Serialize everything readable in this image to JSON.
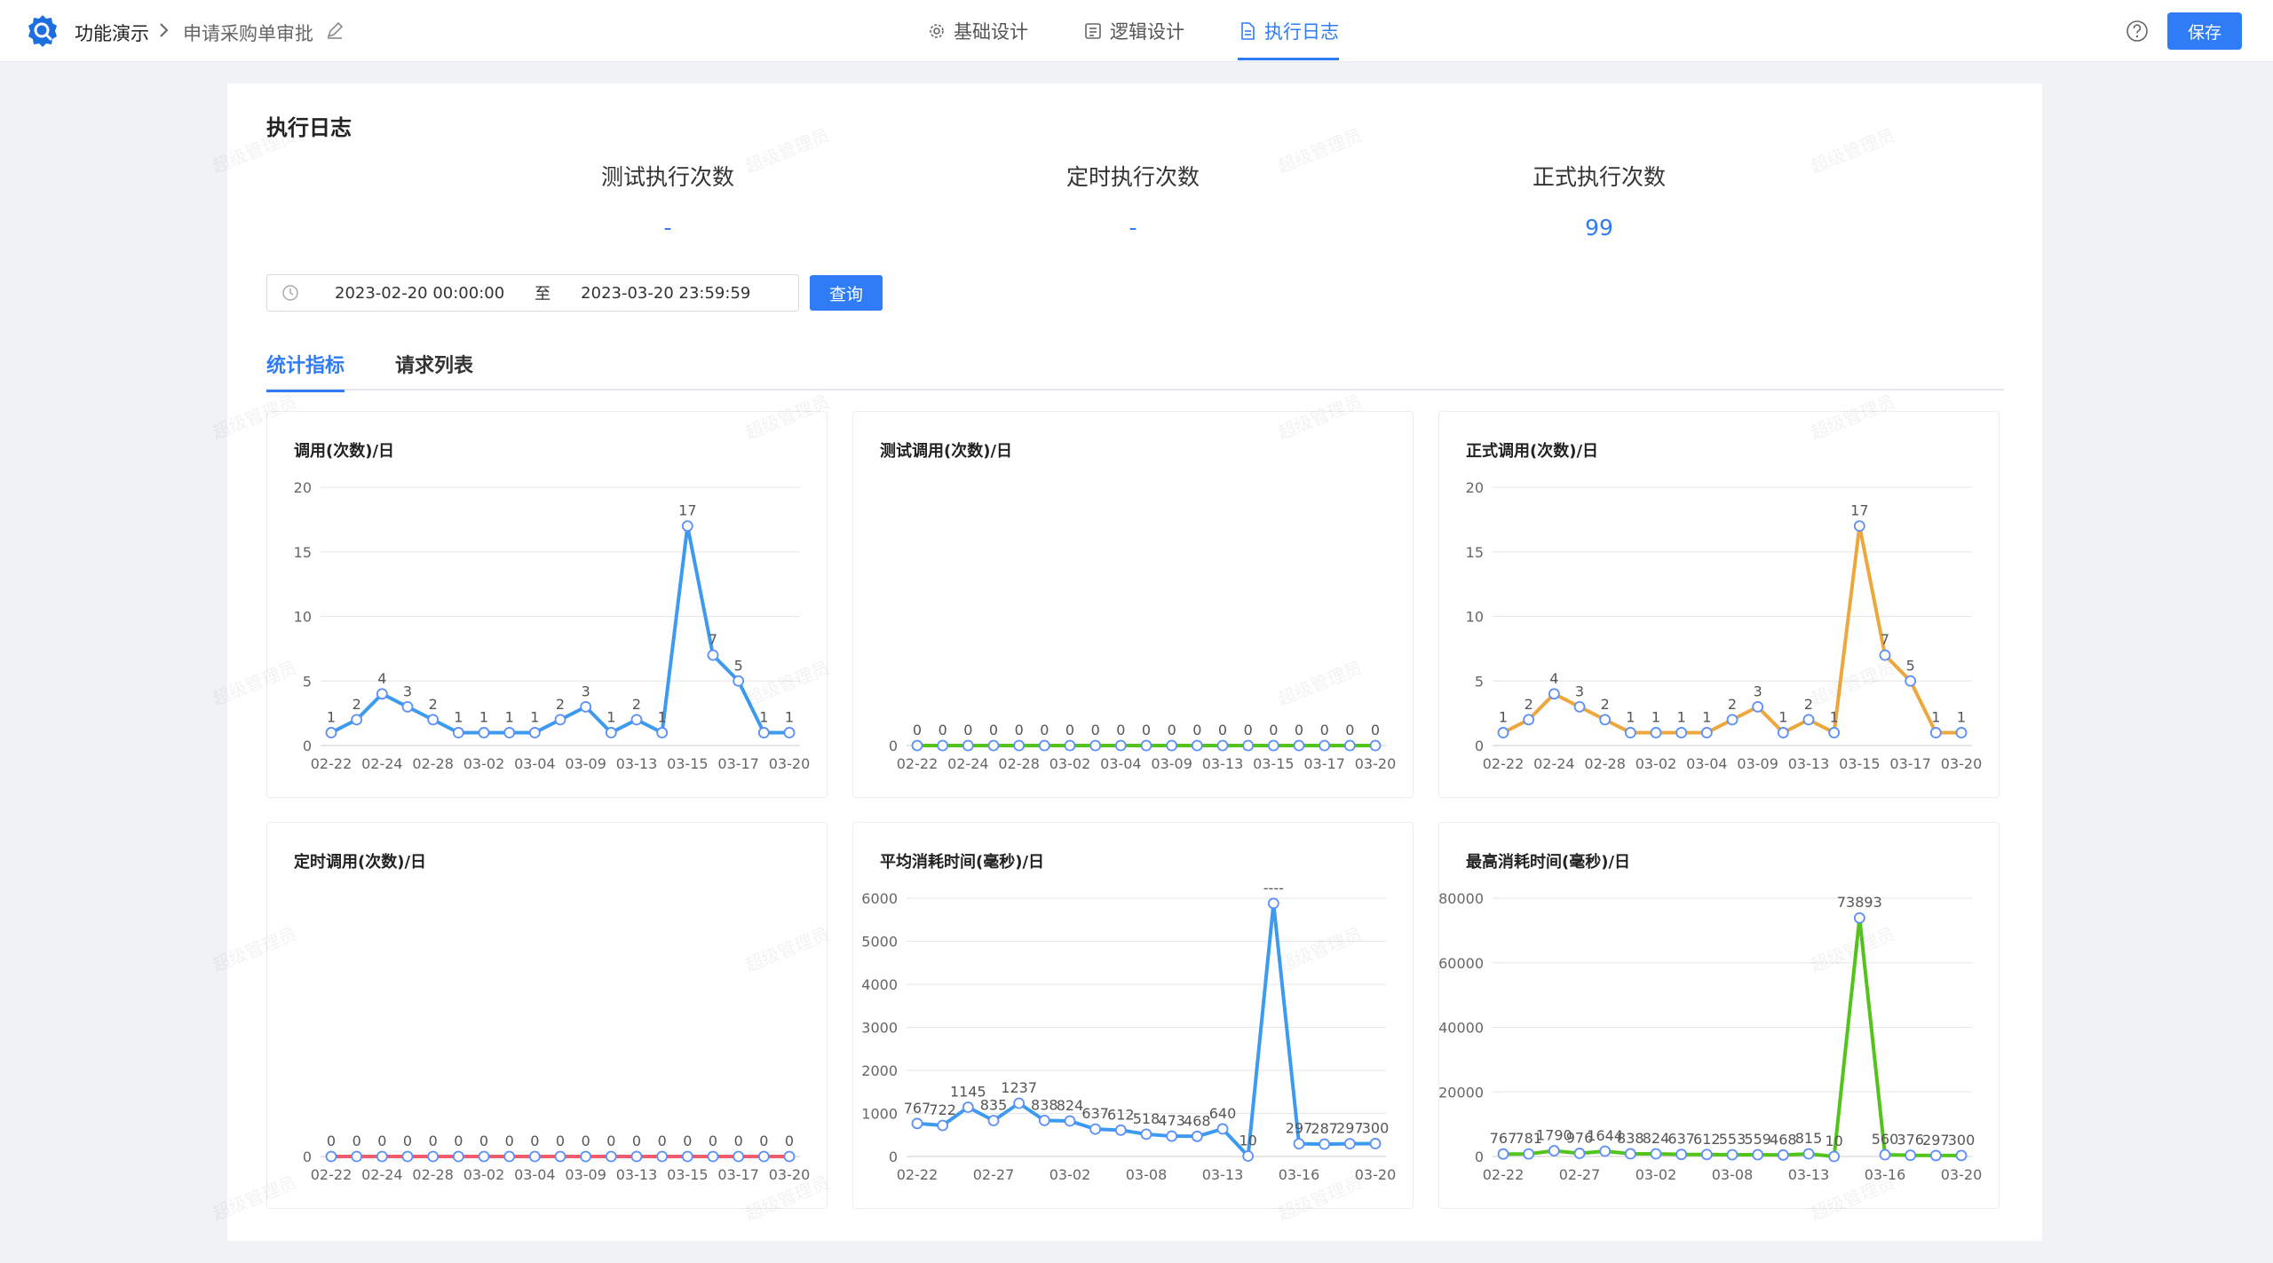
{
  "header": {
    "app_name": "功能演示",
    "page_name": "申请采购单审批",
    "nav": [
      {
        "label": "基础设计",
        "icon": "gear-icon"
      },
      {
        "label": "逻辑设计",
        "icon": "flow-icon"
      },
      {
        "label": "执行日志",
        "icon": "document-icon",
        "active": true
      }
    ],
    "save_label": "保存",
    "accent": "#2f7cf6"
  },
  "panel": {
    "title": "执行日志",
    "stats": [
      {
        "label": "测试执行次数",
        "value": "-"
      },
      {
        "label": "定时执行次数",
        "value": "-"
      },
      {
        "label": "正式执行次数",
        "value": "99"
      }
    ],
    "date_start": "2023-02-20 00:00:00",
    "date_to": "至",
    "date_end": "2023-03-20 23:59:59",
    "query_label": "查询",
    "tabs": [
      "统计指标",
      "请求列表"
    ],
    "watermark": "超级管理员"
  },
  "chart_data": [
    {
      "type": "line",
      "title": "调用(次数)/日",
      "color": "#3d9bef",
      "ylim": [
        0,
        20
      ],
      "yticks": [
        0,
        5,
        10,
        15,
        20
      ],
      "categories": [
        "02-22",
        "02-23",
        "02-24",
        "02-26",
        "02-28",
        "03-01",
        "03-02",
        "03-03",
        "03-04",
        "03-07",
        "03-09",
        "03-10",
        "03-13",
        "03-14",
        "03-15",
        "03-16",
        "03-17",
        "03-19",
        "03-20"
      ],
      "xtick_labels": [
        "02-22",
        "02-24",
        "02-28",
        "03-02",
        "03-04",
        "03-09",
        "03-13",
        "03-15",
        "03-17",
        "03-20"
      ],
      "values": [
        1,
        2,
        4,
        3,
        2,
        1,
        1,
        1,
        1,
        2,
        3,
        1,
        2,
        1,
        17,
        7,
        5,
        1,
        1
      ],
      "labels": [
        "1",
        "2",
        "4",
        "3",
        "2",
        "1",
        "1",
        "1",
        "1",
        "2",
        "3",
        "1",
        "2",
        "1",
        "17",
        "7",
        "5",
        "1",
        "1"
      ]
    },
    {
      "type": "line",
      "title": "测试调用(次数)/日",
      "color": "#52c41a",
      "ylim": [
        0,
        0
      ],
      "yticks": [
        0
      ],
      "categories": [
        "02-22",
        "02-23",
        "02-24",
        "02-26",
        "02-28",
        "03-01",
        "03-02",
        "03-03",
        "03-04",
        "03-07",
        "03-09",
        "03-10",
        "03-13",
        "03-14",
        "03-15",
        "03-16",
        "03-17",
        "03-19",
        "03-20"
      ],
      "xtick_labels": [
        "02-22",
        "02-24",
        "02-28",
        "03-02",
        "03-04",
        "03-09",
        "03-13",
        "03-15",
        "03-17",
        "03-20"
      ],
      "values": [
        0,
        0,
        0,
        0,
        0,
        0,
        0,
        0,
        0,
        0,
        0,
        0,
        0,
        0,
        0,
        0,
        0,
        0,
        0
      ],
      "labels": [
        "0",
        "0",
        "0",
        "0",
        "0",
        "0",
        "0",
        "0",
        "0",
        "0",
        "0",
        "0",
        "0",
        "0",
        "0",
        "0",
        "0",
        "0",
        "0"
      ]
    },
    {
      "type": "line",
      "title": "正式调用(次数)/日",
      "color": "#eea73c",
      "ylim": [
        0,
        20
      ],
      "yticks": [
        0,
        5,
        10,
        15,
        20
      ],
      "categories": [
        "02-22",
        "02-23",
        "02-24",
        "02-26",
        "02-28",
        "03-01",
        "03-02",
        "03-03",
        "03-04",
        "03-07",
        "03-09",
        "03-10",
        "03-13",
        "03-14",
        "03-15",
        "03-16",
        "03-17",
        "03-19",
        "03-20"
      ],
      "xtick_labels": [
        "02-22",
        "02-24",
        "02-28",
        "03-02",
        "03-04",
        "03-09",
        "03-13",
        "03-15",
        "03-17",
        "03-20"
      ],
      "values": [
        1,
        2,
        4,
        3,
        2,
        1,
        1,
        1,
        1,
        2,
        3,
        1,
        2,
        1,
        17,
        7,
        5,
        1,
        1
      ],
      "labels": [
        "1",
        "2",
        "4",
        "3",
        "2",
        "1",
        "1",
        "1",
        "1",
        "2",
        "3",
        "1",
        "2",
        "1",
        "17",
        "7",
        "5",
        "1",
        "1"
      ]
    },
    {
      "type": "line",
      "title": "定时调用(次数)/日",
      "color": "#f05a6b",
      "ylim": [
        0,
        0
      ],
      "yticks": [
        0
      ],
      "categories": [
        "02-22",
        "02-23",
        "02-24",
        "02-26",
        "02-28",
        "03-01",
        "03-02",
        "03-03",
        "03-04",
        "03-07",
        "03-09",
        "03-10",
        "03-13",
        "03-14",
        "03-15",
        "03-16",
        "03-17",
        "03-19",
        "03-20"
      ],
      "xtick_labels": [
        "02-22",
        "02-24",
        "02-28",
        "03-02",
        "03-04",
        "03-09",
        "03-13",
        "03-15",
        "03-17",
        "03-20"
      ],
      "values": [
        0,
        0,
        0,
        0,
        0,
        0,
        0,
        0,
        0,
        0,
        0,
        0,
        0,
        0,
        0,
        0,
        0,
        0,
        0
      ],
      "labels": [
        "0",
        "0",
        "0",
        "0",
        "0",
        "0",
        "0",
        "0",
        "0",
        "0",
        "0",
        "0",
        "0",
        "0",
        "0",
        "0",
        "0",
        "0",
        "0"
      ]
    },
    {
      "type": "line",
      "title": "平均消耗时间(毫秒)/日",
      "color": "#3d9bef",
      "ylim": [
        0,
        6000
      ],
      "yticks": [
        0,
        1000,
        2000,
        3000,
        4000,
        5000,
        6000
      ],
      "categories": [
        "02-22",
        "02-23",
        "02-24",
        "02-26",
        "02-27",
        "02-28",
        "03-01",
        "03-02",
        "03-03",
        "03-04",
        "03-07",
        "03-08",
        "03-09",
        "03-10",
        "03-13",
        "03-14",
        "03-15",
        "03-16",
        "03-17",
        "03-19",
        "03-20"
      ],
      "xtick_labels": [
        "02-22",
        "02-27",
        "03-02",
        "03-08",
        "03-13",
        "03-16",
        "03-20"
      ],
      "values": [
        767,
        722,
        1145,
        835,
        1237,
        838,
        824,
        637,
        612,
        518,
        473,
        468,
        640,
        10,
        5880,
        297,
        287,
        297,
        300
      ],
      "labels": [
        "767",
        "722",
        "1145",
        "835",
        "1237",
        "838",
        "824",
        "637",
        "612",
        "518",
        "473",
        "468",
        "640",
        "10",
        "----",
        "297",
        "287",
        "297",
        "300"
      ]
    },
    {
      "type": "line",
      "title": "最高消耗时间(毫秒)/日",
      "color": "#52c41a",
      "ylim": [
        0,
        80000
      ],
      "yticks": [
        0,
        20000,
        40000,
        60000,
        80000
      ],
      "categories": [
        "02-22",
        "02-23",
        "02-24",
        "02-26",
        "02-27",
        "02-28",
        "03-01",
        "03-02",
        "03-03",
        "03-04",
        "03-07",
        "03-08",
        "03-09",
        "03-10",
        "03-13",
        "03-14",
        "03-15",
        "03-16",
        "03-17",
        "03-19",
        "03-20"
      ],
      "xtick_labels": [
        "02-22",
        "02-27",
        "03-02",
        "03-08",
        "03-13",
        "03-16",
        "03-20"
      ],
      "values": [
        767,
        781,
        1790,
        976,
        1644,
        838,
        824,
        637,
        612,
        553,
        559,
        468,
        815,
        10,
        73893,
        560,
        376,
        297,
        300
      ],
      "labels": [
        "767",
        "781",
        "1790",
        "976",
        "1644",
        "838",
        "824",
        "637",
        "612",
        "553",
        "559",
        "468",
        "815",
        "10",
        "73893",
        "560",
        "376",
        "297",
        "300"
      ]
    }
  ]
}
